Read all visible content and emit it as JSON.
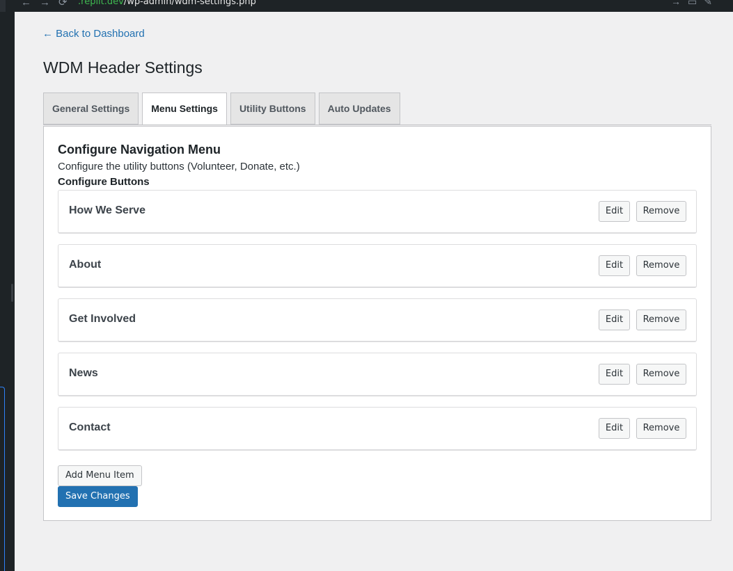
{
  "browser": {
    "url_host": ".replit.dev",
    "url_path": "/wp-admin/wdm-settings.php"
  },
  "page": {
    "back_link": "← Back to Dashboard",
    "title": "WDM Header Settings"
  },
  "tabs": [
    {
      "label": "General Settings",
      "active": false
    },
    {
      "label": "Menu Settings",
      "active": true
    },
    {
      "label": "Utility Buttons",
      "active": false
    },
    {
      "label": "Auto Updates",
      "active": false
    }
  ],
  "panel": {
    "title": "Configure Navigation Menu",
    "description": "Configure the utility buttons (Volunteer, Donate, etc.)",
    "section_label": "Configure Buttons",
    "items": [
      {
        "label": "How We Serve",
        "edit": "Edit",
        "remove": "Remove"
      },
      {
        "label": "About",
        "edit": "Edit",
        "remove": "Remove"
      },
      {
        "label": "Get Involved",
        "edit": "Edit",
        "remove": "Remove"
      },
      {
        "label": "News",
        "edit": "Edit",
        "remove": "Remove"
      },
      {
        "label": "Contact",
        "edit": "Edit",
        "remove": "Remove"
      }
    ],
    "add_button": "Add Menu Item",
    "save_button": "Save Changes"
  },
  "colors": {
    "link": "#2271b1",
    "primary_button": "#2271b1",
    "background": "#f0f0f1"
  }
}
